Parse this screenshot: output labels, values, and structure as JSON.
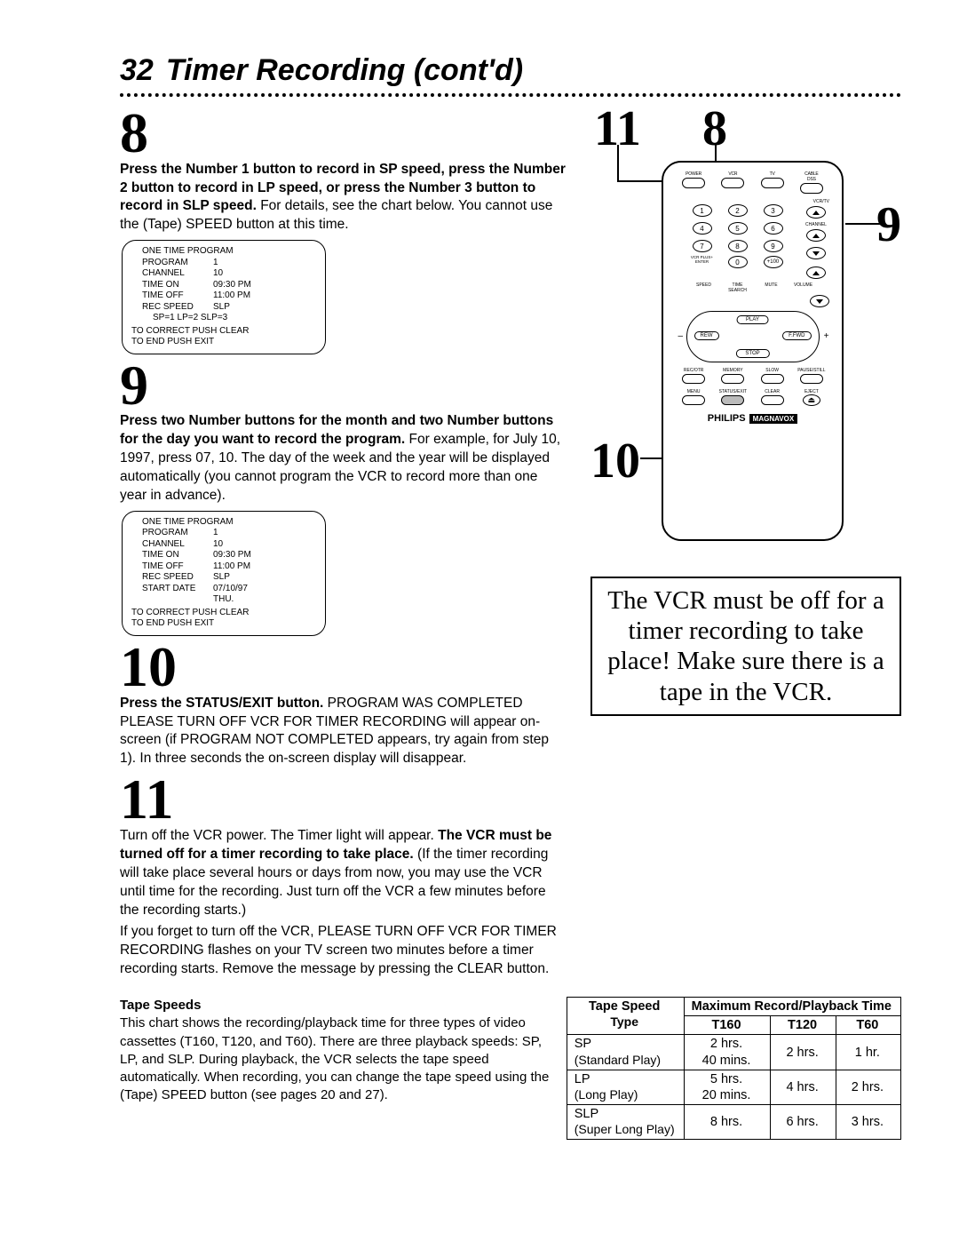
{
  "page": {
    "number": "32",
    "title": "Timer Recording (cont'd)"
  },
  "step8": {
    "num": "8",
    "bold": "Press the Number 1 button to record in SP speed, press the Number 2 button to record in LP speed, or press the Number 3 button to record in SLP speed.",
    "rest": " For details, see the chart below. You cannot use the (Tape) SPEED button at this time."
  },
  "osd1": {
    "title": "ONE TIME PROGRAM",
    "program_k": "PROGRAM",
    "program_v": "1",
    "channel_k": "CHANNEL",
    "channel_v": "10",
    "timeon_k": "TIME ON",
    "timeon_v": "09:30 PM",
    "timeoff_k": "TIME OFF",
    "timeoff_v": "11:00 PM",
    "rec_k": "REC SPEED",
    "rec_v": "SLP",
    "speeds": "SP=1    LP=2    SLP=3",
    "foot1": "TO CORRECT PUSH CLEAR",
    "foot2": "TO END PUSH EXIT"
  },
  "step9": {
    "num": "9",
    "bold": "Press two Number buttons for the month and two Number buttons for the day you want to record the program.",
    "rest": " For example, for July 10, 1997, press 07, 10. The day of the week and the year will be displayed automatically (you cannot program the VCR to record more than one year in advance)."
  },
  "osd2": {
    "title": "ONE TIME PROGRAM",
    "program_k": "PROGRAM",
    "program_v": "1",
    "channel_k": "CHANNEL",
    "channel_v": "10",
    "timeon_k": "TIME ON",
    "timeon_v": "09:30 PM",
    "timeoff_k": "TIME OFF",
    "timeoff_v": "11:00 PM",
    "rec_k": "REC SPEED",
    "rec_v": "SLP",
    "date_k": "START DATE",
    "date_v": "07/10/97",
    "date_day": "THU.",
    "foot1": "TO CORRECT PUSH CLEAR",
    "foot2": "TO END PUSH EXIT"
  },
  "step10": {
    "num": "10",
    "bold": "Press the STATUS/EXIT button.",
    "rest": " PROGRAM WAS COMPLETED PLEASE TURN OFF VCR FOR TIMER RECORDING will appear on-screen (if PROGRAM NOT COMPLETED appears, try again from step 1). In three seconds the on-screen display will disappear."
  },
  "step11": {
    "num": "11",
    "pre": "Turn off the VCR power. The Timer light will appear. ",
    "bold": "The VCR must be turned off for a timer recording to take place.",
    "rest1": " (If the timer recording will take place several hours or days from now, you may use the VCR until time for the recording. Just turn off the VCR a few minutes before the recording starts.)",
    "rest2": "If you forget to turn off the VCR, PLEASE TURN OFF VCR FOR TIMER RECORDING flashes on your TV screen two minutes before a timer recording starts. Remove the message by pressing the CLEAR button."
  },
  "remote": {
    "top": {
      "power": "POWER",
      "vcr": "VCR",
      "tv": "TV",
      "cable": "CABLE\nDSS"
    },
    "vcrtv": "VCR/TV",
    "channel": "CHANNEL",
    "plus100": "+100",
    "enter_lbl": "VCR PLUS+\nENTER",
    "bottom_lbls": {
      "speed": "SPEED",
      "timesearch": "TIME SEARCH",
      "mute": "MUTE",
      "volume": "VOLUME"
    },
    "trans": {
      "play": "PLAY",
      "rew": "REW",
      "ffwd": "F.FWD",
      "stop": "STOP"
    },
    "row1": {
      "recotr": "REC/OTR",
      "memory": "MEMORY",
      "slow": "SLOW",
      "pause": "PAUSE/STILL"
    },
    "row2": {
      "menu": "MENU",
      "status": "STATUS/EXIT",
      "clear": "CLEAR",
      "eject": "EJECT"
    },
    "brand": "PHILIPS",
    "brand2": "MAGNAVOX"
  },
  "callouts": {
    "c11": "11",
    "c8": "8",
    "c9": "9",
    "c10": "10"
  },
  "warning": "The VCR must be off for a timer recording to take place! Make sure there is a tape in the VCR.",
  "speeds": {
    "heading": "Tape Speeds",
    "text": "This chart shows the recording/playback time for three types of video cassettes (T160, T120, and T60). There are three playback speeds: SP, LP, and SLP. During playback, the VCR selects the tape speed automatically. When recording, you can change the tape speed using the (Tape) SPEED button (see pages 20 and 27).",
    "h_speed": "Tape Speed",
    "h_max": "Maximum Record/Playback Time",
    "h_type": "Type",
    "h_t160": "T160",
    "h_t120": "T120",
    "h_t60": "T60",
    "sp_a": "SP",
    "sp_b": "(Standard Play)",
    "lp_a": "LP",
    "lp_b": "(Long Play)",
    "slp_a": "SLP",
    "slp_b": "(Super Long Play)",
    "sp_160a": "2 hrs.",
    "sp_160b": "40 mins.",
    "sp_120": "2 hrs.",
    "sp_60": "1 hr.",
    "lp_160a": "5 hrs.",
    "lp_160b": "20 mins.",
    "lp_120": "4 hrs.",
    "lp_60": "2 hrs.",
    "slp_160": "8 hrs.",
    "slp_120": "6 hrs.",
    "slp_60": "3 hrs."
  }
}
